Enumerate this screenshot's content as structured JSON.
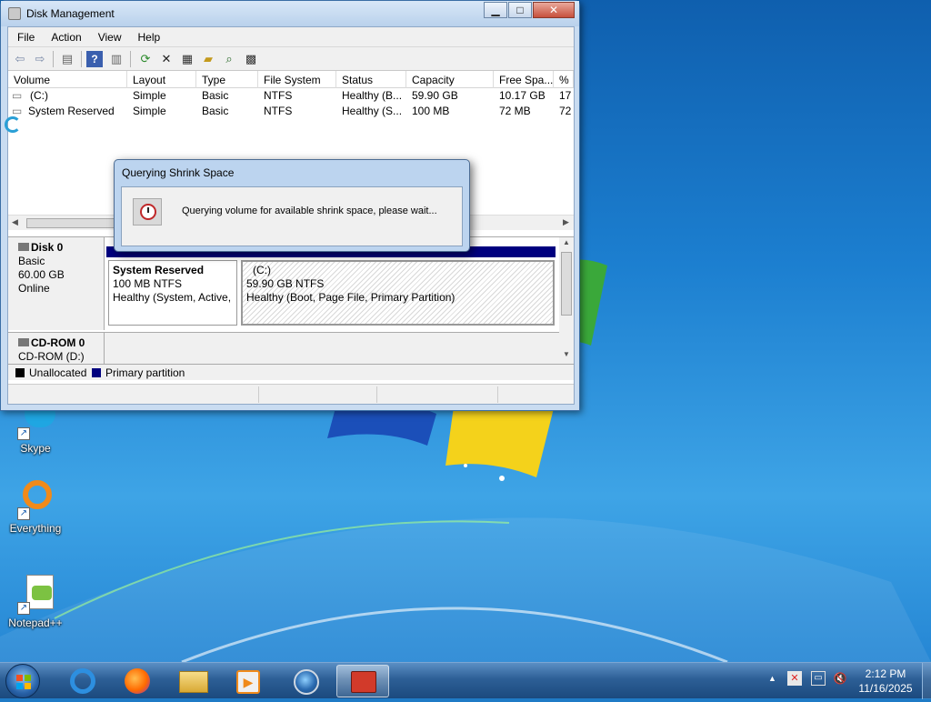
{
  "window": {
    "title": "Disk Management",
    "menu": [
      "File",
      "Action",
      "View",
      "Help"
    ],
    "columns": [
      "Volume",
      "Layout",
      "Type",
      "File System",
      "Status",
      "Capacity",
      "Free Spa...",
      "% F"
    ],
    "rows": [
      {
        "volume": "(C:)",
        "layout": "Simple",
        "type": "Basic",
        "fs": "NTFS",
        "status": "Healthy (B...",
        "capacity": "59.90 GB",
        "free": "10.17 GB",
        "pct": "17"
      },
      {
        "volume": "System Reserved",
        "layout": "Simple",
        "type": "Basic",
        "fs": "NTFS",
        "status": "Healthy (S...",
        "capacity": "100 MB",
        "free": "72 MB",
        "pct": "72"
      }
    ],
    "disk0": {
      "name": "Disk 0",
      "type": "Basic",
      "size": "60.00 GB",
      "state": "Online",
      "partitions": [
        {
          "name": "System Reserved",
          "detail": "100 MB NTFS",
          "status": "Healthy (System, Active,"
        },
        {
          "name": "(C:)",
          "detail": "59.90 GB NTFS",
          "status": "Healthy (Boot, Page File, Primary Partition)"
        }
      ]
    },
    "cdrom": {
      "name": "CD-ROM 0",
      "sub": "CD-ROM (D:)"
    },
    "legend": {
      "unallocated": "Unallocated",
      "primary": "Primary partition"
    }
  },
  "dialog": {
    "title": "Querying Shrink Space",
    "message": "Querying volume for available shrink space, please wait..."
  },
  "desktop": {
    "icons": [
      "Skype",
      "Everything",
      "Notepad++"
    ]
  },
  "taskbar": {
    "time": "2:12 PM",
    "date": "11/16/2025"
  },
  "colors": {
    "unallocated": "#000000",
    "primary": "#00007f",
    "taskbar": "#2d5f96"
  }
}
